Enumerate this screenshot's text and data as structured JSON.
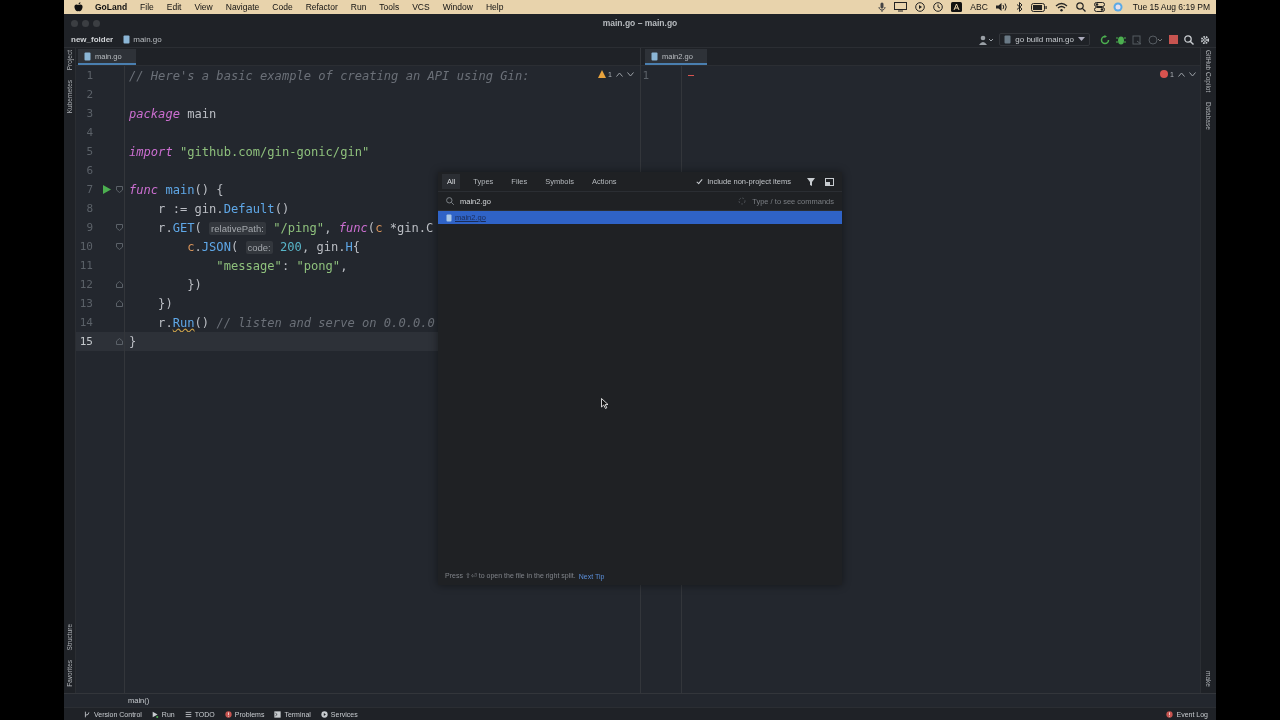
{
  "menu_bar": {
    "app": "GoLand",
    "items": [
      "File",
      "Edit",
      "View",
      "Navigate",
      "Code",
      "Refactor",
      "Run",
      "Tools",
      "VCS",
      "Window",
      "Help"
    ],
    "input_source": "ABC",
    "clock": "Tue 15 Aug  6:19 PM"
  },
  "window": {
    "title": "main.go – main.go"
  },
  "nav_bar": {
    "crumbs": [
      "new_folder",
      "main.go"
    ],
    "run_config": "go build main.go"
  },
  "left_strip": {
    "top_tools": [
      "Project",
      "Kubernetes"
    ],
    "bottom_tools": [
      "Structure",
      "Favorites"
    ]
  },
  "right_strip": {
    "top_tools": [
      "GitHub Copilot",
      "Database"
    ],
    "bottom_tools": [
      "make"
    ]
  },
  "editors": [
    {
      "tab": {
        "label": "main.go",
        "selected": true
      },
      "inspection": {
        "kind": "warning",
        "count": "1"
      },
      "lines": [
        {
          "n": "1",
          "current": false,
          "tokens": [
            {
              "kind": "comment",
              "t": "// Here's a basic example of creating an API using Gin:"
            }
          ]
        },
        {
          "n": "2",
          "current": false
        },
        {
          "n": "3",
          "current": false,
          "tokens": [
            {
              "kind": "kw",
              "t": "package"
            },
            {
              "kind": "plain",
              "t": " main"
            }
          ]
        },
        {
          "n": "4",
          "current": false
        },
        {
          "n": "5",
          "current": false,
          "tokens": [
            {
              "kind": "kw",
              "t": "import"
            },
            {
              "kind": "str",
              "t": " \"github.com/gin-gonic/gin\""
            }
          ]
        },
        {
          "n": "6",
          "current": false
        },
        {
          "n": "7",
          "current": false,
          "run": true,
          "fold_start": true,
          "tokens": [
            {
              "kind": "kw",
              "t": "func"
            },
            {
              "kind": "fn",
              "t": " main"
            },
            {
              "kind": "plain",
              "t": "() {"
            }
          ]
        },
        {
          "n": "8",
          "current": false,
          "tokens": [
            {
              "kind": "plain",
              "t": "    r := gin."
            },
            {
              "kind": "fn",
              "t": "Default"
            },
            {
              "kind": "plain",
              "t": "()"
            }
          ]
        },
        {
          "n": "9",
          "current": false,
          "fold_start": true,
          "tokens": [
            {
              "kind": "plain",
              "t": "    r."
            },
            {
              "kind": "fn",
              "t": "GET"
            },
            {
              "kind": "plain",
              "t": "( "
            },
            {
              "kind": "hint",
              "t": "relativePath:"
            },
            {
              "kind": "str",
              "t": " \"/ping\""
            },
            {
              "kind": "plain",
              "t": ", "
            },
            {
              "kind": "kw",
              "t": "func"
            },
            {
              "kind": "plain",
              "t": "("
            },
            {
              "kind": "param",
              "t": "c"
            },
            {
              "kind": "plain",
              "t": " *gin.C"
            }
          ]
        },
        {
          "n": "10",
          "current": false,
          "fold_start": true,
          "tokens": [
            {
              "kind": "param",
              "t": "        c"
            },
            {
              "kind": "plain",
              "t": "."
            },
            {
              "kind": "fn",
              "t": "JSON"
            },
            {
              "kind": "plain",
              "t": "( "
            },
            {
              "kind": "hint",
              "t": "code:"
            },
            {
              "kind": "num",
              "t": " 200"
            },
            {
              "kind": "plain",
              "t": ", gin."
            },
            {
              "kind": "fn",
              "t": "H"
            },
            {
              "kind": "plain",
              "t": "{"
            }
          ]
        },
        {
          "n": "11",
          "current": false,
          "tokens": [
            {
              "kind": "str",
              "t": "            \"message\""
            },
            {
              "kind": "plain",
              "t": ": "
            },
            {
              "kind": "str",
              "t": "\"pong\""
            },
            {
              "kind": "plain",
              "t": ","
            }
          ]
        },
        {
          "n": "12",
          "current": false,
          "fold_end": true,
          "tokens": [
            {
              "kind": "plain",
              "t": "        })"
            }
          ]
        },
        {
          "n": "13",
          "current": false,
          "fold_end": true,
          "tokens": [
            {
              "kind": "plain",
              "t": "    })"
            }
          ]
        },
        {
          "n": "14",
          "current": false,
          "tokens": [
            {
              "kind": "plain",
              "t": "    r."
            },
            {
              "kind": "err",
              "t": "Run"
            },
            {
              "kind": "plain",
              "t": "() "
            },
            {
              "kind": "comment",
              "t": "// listen and serve on 0.0.0.0"
            }
          ]
        },
        {
          "n": "15",
          "current": true,
          "fold_end": true,
          "tokens": [
            {
              "kind": "plain",
              "t": "}"
            }
          ]
        }
      ]
    },
    {
      "tab": {
        "label": "main2.go",
        "selected": true
      },
      "inspection": {
        "kind": "error",
        "count": "1"
      },
      "lines": [
        {
          "n": "1",
          "current": false
        }
      ]
    }
  ],
  "popup": {
    "tabs": [
      {
        "label": "All",
        "selected": true
      },
      {
        "label": "Types",
        "selected": false
      },
      {
        "label": "Files",
        "selected": false
      },
      {
        "label": "Symbols",
        "selected": false
      },
      {
        "label": "Actions",
        "selected": false
      }
    ],
    "include_option": {
      "label": "Include non-project items",
      "checked": true
    },
    "search": {
      "value": "main2.go",
      "hint": "Type / to see commands"
    },
    "results": [
      {
        "label": "main2.go",
        "selected": true
      }
    ],
    "tip": {
      "text": "Press ⇧⏎ to open the file in the right split.",
      "link": "Next Tip"
    }
  },
  "breadcrumb": "main()",
  "status_bar": {
    "tools": [
      {
        "kind": "vcs",
        "label": "Version Control"
      },
      {
        "kind": "run",
        "label": "Run"
      },
      {
        "kind": "todo",
        "label": "TODO"
      },
      {
        "kind": "problems",
        "label": "Problems"
      },
      {
        "kind": "terminal",
        "label": "Terminal"
      },
      {
        "kind": "services",
        "label": "Services"
      }
    ],
    "event_log": "Event Log"
  }
}
